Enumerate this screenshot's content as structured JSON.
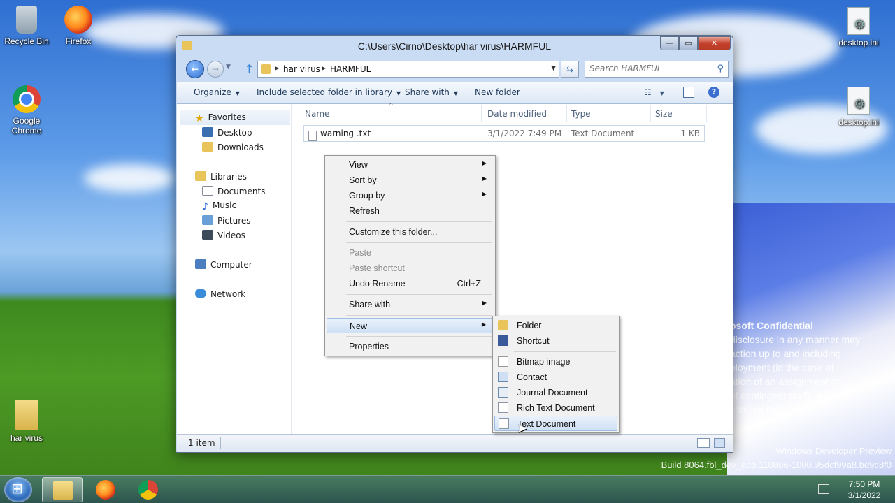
{
  "desktop": {
    "icons": [
      {
        "label": "Recycle Bin"
      },
      {
        "label": "Firefox"
      },
      {
        "label": "Google Chrome"
      },
      {
        "label": "har virus"
      },
      {
        "label": "desktop.ini"
      },
      {
        "label": "desktop.ini"
      }
    ],
    "watermark": {
      "title": "osoft Confidential",
      "lines": [
        "disclosure in any manner may",
        "action up to and including",
        "ployment (in the case of",
        "ation of an assignment or",
        "of contingent staff), and",
        "criminal liability."
      ],
      "build1": "Windows Developer Preview",
      "build2": "Build 8064.fbl_dev_app.110806-1000.95dcf99a8.bd9c8f0"
    }
  },
  "window": {
    "title": "C:\\Users\\Cirno\\Desktop\\har virus\\HARMFUL",
    "caption": {
      "minimize": "—",
      "maximize": "▭",
      "close": "✕"
    },
    "breadcrumb": [
      "har virus",
      "HARMFUL"
    ],
    "search_placeholder": "Search HARMFUL",
    "toolbar": {
      "organize": "Organize",
      "include": "Include selected folder in library",
      "share": "Share with",
      "new_folder": "New folder"
    },
    "nav_pane": {
      "favorites": "Favorites",
      "desktop": "Desktop",
      "downloads": "Downloads",
      "libraries": "Libraries",
      "documents": "Documents",
      "music": "Music",
      "pictures": "Pictures",
      "videos": "Videos",
      "computer": "Computer",
      "network": "Network"
    },
    "columns": {
      "name": "Name",
      "date": "Date modified",
      "type": "Type",
      "size": "Size"
    },
    "files": [
      {
        "name": "warning .txt",
        "date": "3/1/2022 7:49 PM",
        "type": "Text Document",
        "size": "1 KB"
      }
    ],
    "status": "1 item"
  },
  "context_menu": {
    "view": "View",
    "sort_by": "Sort by",
    "group_by": "Group by",
    "refresh": "Refresh",
    "customize": "Customize this folder...",
    "paste": "Paste",
    "paste_shortcut": "Paste shortcut",
    "undo_rename": "Undo Rename",
    "undo_shortcut": "Ctrl+Z",
    "share_with": "Share with",
    "new": "New",
    "properties": "Properties"
  },
  "new_submenu": {
    "folder": "Folder",
    "shortcut": "Shortcut",
    "bitmap": "Bitmap image",
    "contact": "Contact",
    "journal": "Journal Document",
    "rtf": "Rich Text Document",
    "text": "Text Document"
  },
  "taskbar": {
    "time": "7:50 PM",
    "date": "3/1/2022"
  }
}
